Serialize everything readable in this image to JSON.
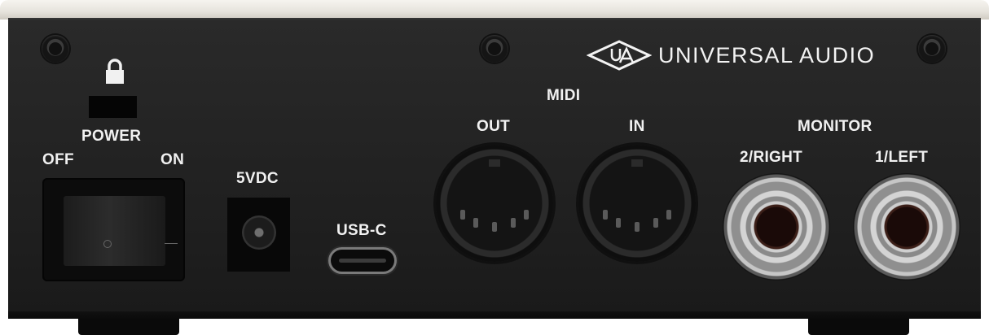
{
  "brand": {
    "name": "UNIVERSAL AUDIO",
    "logo_icon": "ua-diamond-logo"
  },
  "power": {
    "title": "POWER",
    "off_label": "OFF",
    "on_label": "ON",
    "lock_icon": "lock-icon"
  },
  "dc_input": {
    "label": "5VDC"
  },
  "usb": {
    "label": "USB-C"
  },
  "midi": {
    "title": "MIDI",
    "out_label": "OUT",
    "in_label": "IN"
  },
  "monitor": {
    "title": "MONITOR",
    "right_label": "2/RIGHT",
    "left_label": "1/LEFT"
  },
  "colors": {
    "panel": "#222222",
    "label": "#f1f1f1",
    "trim": "#ece9e3"
  }
}
